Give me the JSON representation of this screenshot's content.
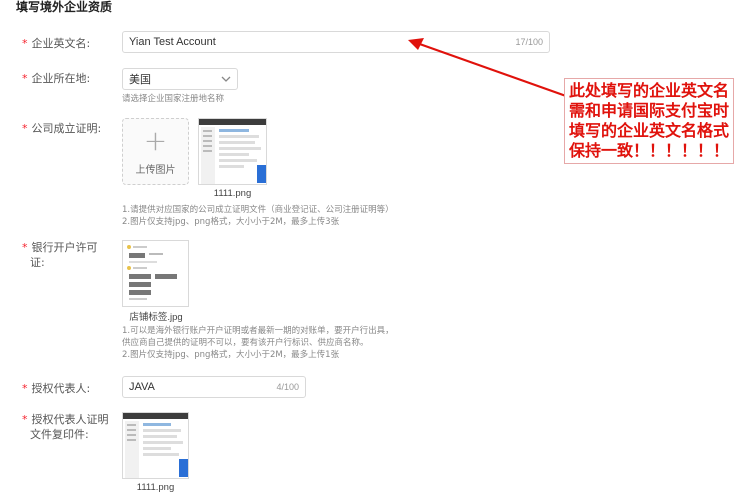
{
  "section": {
    "title": "填写境外企业资质"
  },
  "form": {
    "required_mark": "*",
    "company_name": {
      "label": "企业英文名:",
      "value": "Yian Test Account",
      "counter": "17/100"
    },
    "location": {
      "label": "企业所在地:",
      "value": "美国",
      "hint": "请选择企业国家注册地名称"
    },
    "incorporation_proof": {
      "label": "公司成立证明:",
      "upload_label": "上传图片",
      "file_name": "1111.png",
      "hint_line1": "1.请提供对应国家的公司成立证明文件（商业登记证、公司注册证明等）",
      "hint_line2": "2.图片仅支持jpg、png格式，大小小于2M，最多上传3张"
    },
    "bank_permit": {
      "label_line1": "银行开户许可",
      "label_line2": "证:",
      "file_name": "店铺标签.jpg",
      "hint_line1": "1.可以是海外银行账户开户证明或者最新一期的对账单，要开户行出具，",
      "hint_line2": "供应商自己提供的证明不可以，要有该开户行标识、供应商名称。",
      "hint_line3": "2.图片仅支持jpg、png格式，大小小于2M，最多上传1张"
    },
    "representative": {
      "label": "授权代表人:",
      "value": "JAVA",
      "counter": "4/100"
    },
    "rep_id_copy": {
      "label_line1": "授权代表人证明",
      "label_line2": "文件复印件:",
      "file_name": "1111.png"
    }
  },
  "annotation": {
    "line1": "此处填写的企业英文名",
    "line2": "需和申请国际支付宝时",
    "line3": "填写的企业英文名格式",
    "line4": "保持一致！！！！！！",
    "color": "#e0120c"
  },
  "icons": {
    "dropdown": "chevron-down-icon",
    "upload": "plus-icon"
  }
}
